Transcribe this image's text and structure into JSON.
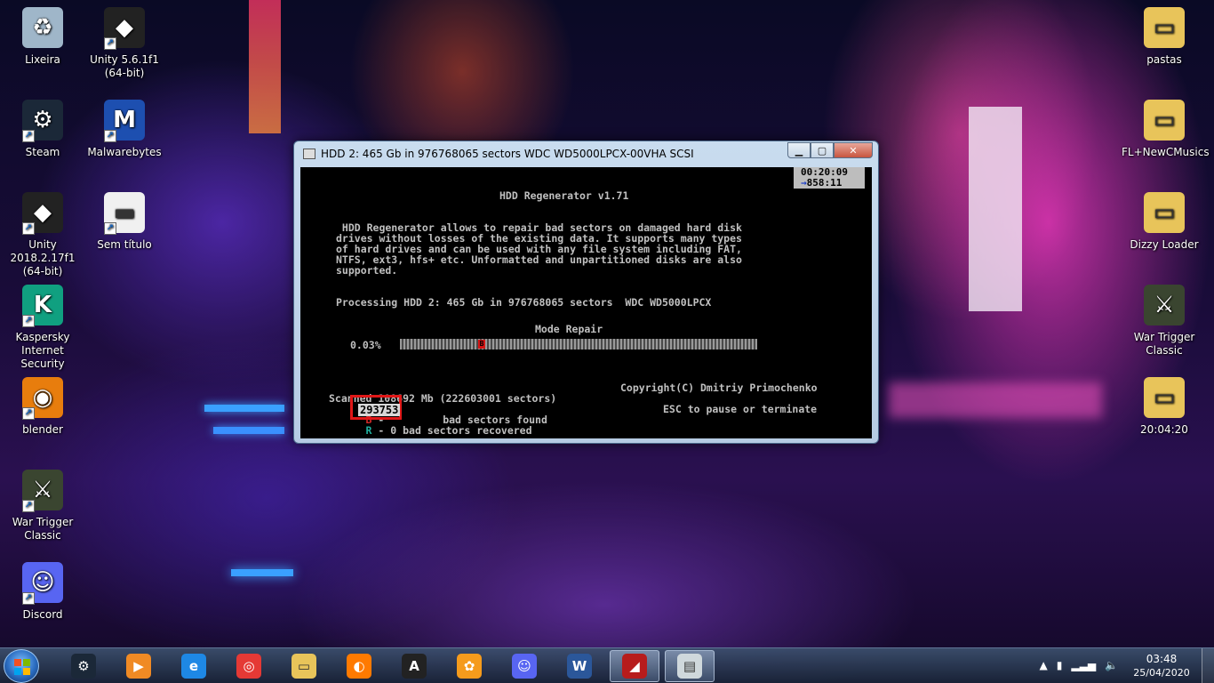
{
  "desktop": {
    "icons_left": [
      {
        "name": "recycle-bin",
        "label": "Lixeira",
        "icon": "recycle-bin-icon"
      },
      {
        "name": "unity-561",
        "label": "Unity 5.6.1f1\n(64-bit)",
        "icon": "unity-icon"
      },
      {
        "name": "steam",
        "label": "Steam",
        "icon": "steam-icon"
      },
      {
        "name": "malwarebytes",
        "label": "Malwarebytes",
        "icon": "malwarebytes-icon"
      },
      {
        "name": "unity-2018",
        "label": "Unity 2018.2.17f1\n(64-bit)",
        "icon": "unity-icon"
      },
      {
        "name": "sem-titulo",
        "label": "Sem título",
        "icon": "document-icon"
      },
      {
        "name": "kaspersky",
        "label": "Kaspersky\nInternet Security",
        "icon": "kaspersky-icon"
      },
      {
        "name": "blender",
        "label": "blender",
        "icon": "blender-icon"
      },
      {
        "name": "war-trigger-left",
        "label": "War Trigger\nClassic",
        "icon": "war-trigger-icon"
      },
      {
        "name": "discord",
        "label": "Discord",
        "icon": "discord-icon"
      }
    ],
    "icons_right": [
      {
        "name": "pastas",
        "label": "pastas",
        "icon": "folder-icon"
      },
      {
        "name": "fl-newcmusics",
        "label": "FL+NewCMusics",
        "icon": "folder-icon"
      },
      {
        "name": "dizzy-loader",
        "label": "Dizzy Loader",
        "icon": "folder-icon"
      },
      {
        "name": "war-trigger-right",
        "label": "War Trigger\nClassic",
        "icon": "war-trigger-icon"
      },
      {
        "name": "folder-date",
        "label": "20:04:20",
        "icon": "folder-icon"
      }
    ]
  },
  "window": {
    "title": "HDD 2: 465 Gb in 976768065 sectors  WDC WD5000LPCX-00VHA SCSI",
    "timer_elapsed": "00:20:09",
    "timer_remaining": "858:11",
    "app_title": "HDD Regenerator v1.71",
    "description": [
      " HDD Regenerator allows to repair bad sectors on damaged hard disk",
      "drives without losses of the existing data. It supports many types",
      "of hard drives and can be used with any file system including FAT,",
      "NTFS, ext3, hfs+ etc. Unformatted and unpartitioned disks are also",
      "supported."
    ],
    "processing": "Processing HDD 2: 465 Gb in 976768065 sectors  WDC WD5000LPCX",
    "mode": "Mode Repair",
    "progress_percent": "0.03%",
    "progress_fraction": 0.0003,
    "progress_marker": "B",
    "scanned": "Scanned 108692 Mb (222603001 sectors)",
    "bad_prefix": "B",
    "bad_count": "293753",
    "bad_suffix": "bad sectors found",
    "recovered_prefix": "R",
    "recovered_text": "- 0 bad sectors recovered",
    "copyright": "Copyright(C) Dmitriy Primochenko",
    "esc_hint": "ESC to pause or terminate"
  },
  "taskbar": {
    "apps": [
      {
        "name": "steam",
        "icon": "steam-icon"
      },
      {
        "name": "media-player",
        "icon": "media-player-icon"
      },
      {
        "name": "internet-explorer",
        "icon": "ie-icon"
      },
      {
        "name": "chrome",
        "icon": "chrome-icon"
      },
      {
        "name": "file-explorer",
        "icon": "folder-icon"
      },
      {
        "name": "firefox",
        "icon": "firefox-icon"
      },
      {
        "name": "avast-app",
        "icon": "a-circle-icon"
      },
      {
        "name": "fl-studio",
        "icon": "fl-studio-icon"
      },
      {
        "name": "discord",
        "icon": "discord-icon"
      },
      {
        "name": "word",
        "icon": "word-icon"
      },
      {
        "name": "hdd-regenerator",
        "icon": "hdd-regenerator-icon"
      },
      {
        "name": "console-window",
        "icon": "console-icon"
      }
    ],
    "time": "03:48",
    "date": "25/04/2020"
  }
}
